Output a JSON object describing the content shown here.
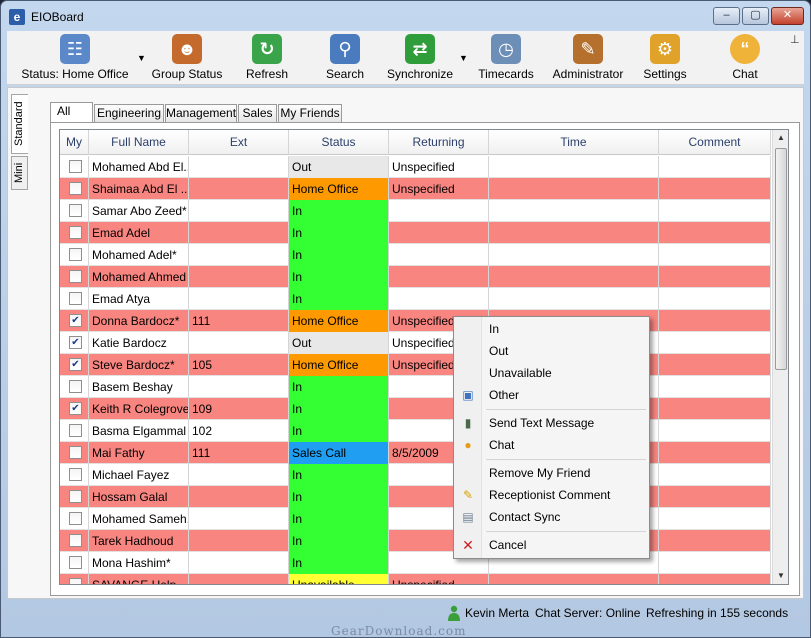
{
  "window": {
    "title": "EIOBoard",
    "minimize": "–",
    "maximize": "▢",
    "close": "✕"
  },
  "toolbar": {
    "buttons": [
      {
        "label": "Status: Home Office",
        "icon": "status-icon"
      },
      {
        "label": "Group Status",
        "icon": "group-icon"
      },
      {
        "label": "Refresh",
        "icon": "refresh-icon"
      },
      {
        "label": "Search",
        "icon": "search-icon"
      },
      {
        "label": "Synchronize",
        "icon": "sync-icon"
      },
      {
        "label": "Timecards",
        "icon": "timecard-icon"
      },
      {
        "label": "Administrator",
        "icon": "admin-icon"
      },
      {
        "label": "Settings",
        "icon": "settings-icon"
      },
      {
        "label": "Chat",
        "icon": "chat-icon"
      }
    ],
    "arrow": "▼",
    "pin": "⊥"
  },
  "views": {
    "standard": "Standard",
    "mini": "Mini"
  },
  "tabs": [
    "All",
    "Engineering",
    "Management",
    "Sales",
    "My Friends"
  ],
  "columns": [
    "My",
    "Full Name",
    "Ext",
    "Status",
    "Returning",
    "Time",
    "Comment"
  ],
  "rows": [
    {
      "checked": false,
      "name": "Mohamed Abd El...",
      "ext": "",
      "status": "Out",
      "returning": "Unspecified",
      "time": "",
      "comment": ""
    },
    {
      "checked": false,
      "name": "Shaimaa Abd El ...",
      "ext": "",
      "status": "Home Office",
      "returning": "Unspecified",
      "time": "",
      "comment": ""
    },
    {
      "checked": false,
      "name": "Samar Abo Zeed*",
      "ext": "",
      "status": "In",
      "returning": "",
      "time": "",
      "comment": ""
    },
    {
      "checked": false,
      "name": "Emad Adel",
      "ext": "",
      "status": "In",
      "returning": "",
      "time": "",
      "comment": ""
    },
    {
      "checked": false,
      "name": "Mohamed Adel*",
      "ext": "",
      "status": "In",
      "returning": "",
      "time": "",
      "comment": ""
    },
    {
      "checked": false,
      "name": "Mohamed Ahmed",
      "ext": "",
      "status": "In",
      "returning": "",
      "time": "",
      "comment": ""
    },
    {
      "checked": false,
      "name": "Emad Atya",
      "ext": "",
      "status": "In",
      "returning": "",
      "time": "",
      "comment": ""
    },
    {
      "checked": true,
      "name": "Donna Bardocz*",
      "ext": "111",
      "status": "Home Office",
      "returning": "Unspecified",
      "time": "",
      "comment": ""
    },
    {
      "checked": true,
      "name": "Katie Bardocz",
      "ext": "",
      "status": "Out",
      "returning": "Unspecified",
      "time": "",
      "comment": ""
    },
    {
      "checked": true,
      "name": "Steve Bardocz*",
      "ext": "105",
      "status": "Home Office",
      "returning": "Unspecified",
      "time": "",
      "comment": ""
    },
    {
      "checked": false,
      "name": "Basem Beshay",
      "ext": "",
      "status": "In",
      "returning": "",
      "time": "",
      "comment": ""
    },
    {
      "checked": true,
      "name": "Keith R Colegrove*",
      "ext": "109",
      "status": "In",
      "returning": "",
      "time": "",
      "comment": ""
    },
    {
      "checked": false,
      "name": "Basma Elgammal",
      "ext": "102",
      "status": "In",
      "returning": "",
      "time": "",
      "comment": ""
    },
    {
      "checked": false,
      "name": "Mai Fathy",
      "ext": "111",
      "status": "Sales Call",
      "returning": "8/5/2009",
      "time": "",
      "comment": ""
    },
    {
      "checked": false,
      "name": "Michael Fayez",
      "ext": "",
      "status": "In",
      "returning": "",
      "time": "",
      "comment": ""
    },
    {
      "checked": false,
      "name": "Hossam Galal",
      "ext": "",
      "status": "In",
      "returning": "",
      "time": "",
      "comment": ""
    },
    {
      "checked": false,
      "name": "Mohamed Sameh...",
      "ext": "",
      "status": "In",
      "returning": "",
      "time": "",
      "comment": ""
    },
    {
      "checked": false,
      "name": "Tarek Hadhoud",
      "ext": "",
      "status": "In",
      "returning": "",
      "time": "",
      "comment": ""
    },
    {
      "checked": false,
      "name": "Mona Hashim*",
      "ext": "",
      "status": "In",
      "returning": "",
      "time": "",
      "comment": ""
    },
    {
      "checked": false,
      "name": "SAVANGE Help...",
      "ext": "",
      "status": "Unavailable",
      "returning": "Unspecified",
      "time": "",
      "comment": ""
    }
  ],
  "check_glyph": "✔",
  "scrollbar": {
    "up": "▲",
    "down": "▼"
  },
  "context_menu": {
    "items": [
      {
        "label": "In",
        "icon": ""
      },
      {
        "label": "Out",
        "icon": ""
      },
      {
        "label": "Unavailable",
        "icon": ""
      },
      {
        "label": "Other",
        "icon": "other-status-icon"
      },
      {
        "label": "Send Text Message",
        "icon": "phone-icon"
      },
      {
        "label": "Chat",
        "icon": "chat-bubble-icon"
      },
      {
        "label": "Remove My Friend",
        "icon": ""
      },
      {
        "label": "Receptionist Comment",
        "icon": "note-icon"
      },
      {
        "label": "Contact Sync",
        "icon": "contact-card-icon"
      },
      {
        "label": "Cancel",
        "icon": "cancel-icon"
      }
    ]
  },
  "statusbar": {
    "user": "Kevin Merta",
    "server": "Chat Server: Online",
    "refresh": "Refreshing in 155 seconds"
  },
  "watermark": "GearDownload.com",
  "colors": {
    "row_pink": "#f98580",
    "status_in": "#33ff33",
    "status_home_office": "#ff9900",
    "status_sales_call": "#1f9ef2",
    "status_unavailable": "#ffff33"
  }
}
